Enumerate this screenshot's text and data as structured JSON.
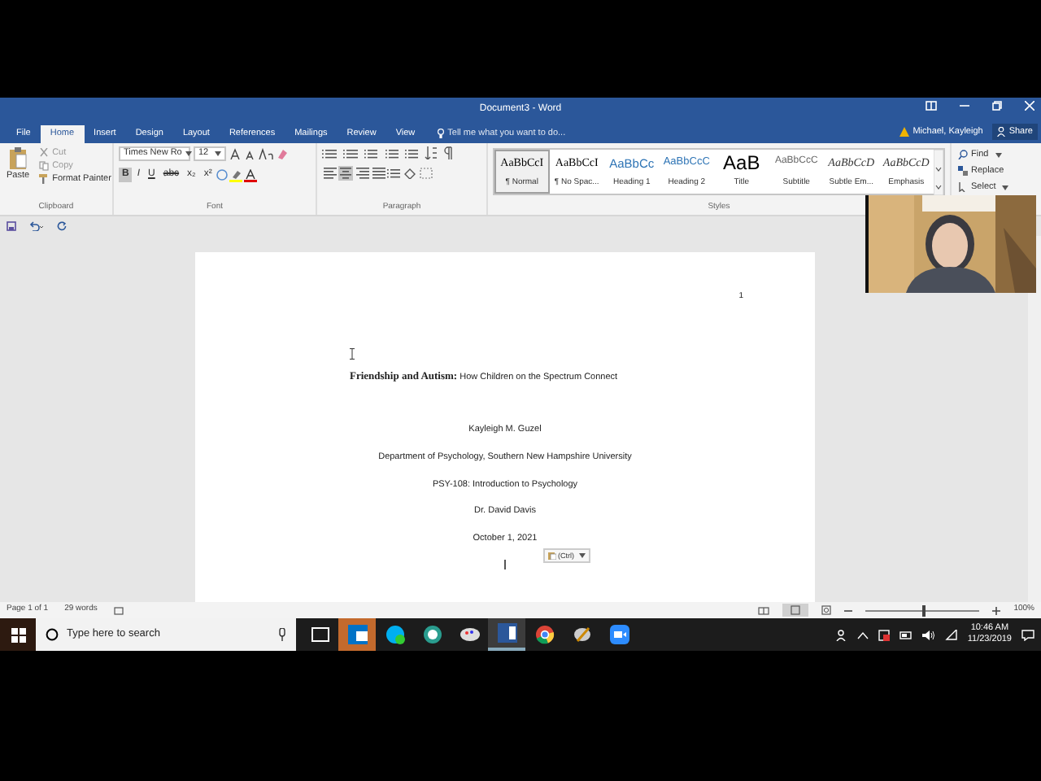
{
  "window": {
    "title": "Document3 - Word"
  },
  "tabs": [
    {
      "label": "File",
      "selected": false
    },
    {
      "label": "Home",
      "selected": true
    },
    {
      "label": "Insert",
      "selected": false
    },
    {
      "label": "Design",
      "selected": false
    },
    {
      "label": "Layout",
      "selected": false
    },
    {
      "label": "References",
      "selected": false
    },
    {
      "label": "Mailings",
      "selected": false
    },
    {
      "label": "Review",
      "selected": false
    },
    {
      "label": "View",
      "selected": false
    }
  ],
  "tell_me": {
    "placeholder": "Tell me what you want to do..."
  },
  "user": "Michael, Kayleigh",
  "share": "Share",
  "clipboard": {
    "paste": "Paste",
    "cut": "Cut",
    "copy": "Copy",
    "format_painter": "Format Painter",
    "label": "Clipboard"
  },
  "font": {
    "name": "Times New Ro",
    "size": "12",
    "label": "Font",
    "formats": [
      {
        "label": "B",
        "on": true
      },
      {
        "label": "I",
        "on": false
      },
      {
        "label": "U",
        "on": false
      },
      {
        "label": "abc",
        "on": false
      },
      {
        "label": "x₂",
        "on": false
      },
      {
        "label": "x²",
        "on": false
      }
    ]
  },
  "paragraph": {
    "label": "Paragraph",
    "alignments": [
      {
        "selected": false
      },
      {
        "selected": true
      },
      {
        "selected": false
      },
      {
        "selected": false
      }
    ]
  },
  "styles": {
    "label": "Styles",
    "items": [
      {
        "preview": "AaBbCcI",
        "name": "¶ Normal",
        "kind": "normal",
        "selected": true
      },
      {
        "preview": "AaBbCcI",
        "name": "¶ No Spac...",
        "kind": "normal",
        "selected": false
      },
      {
        "preview": "AaBbCc",
        "name": "Heading 1",
        "kind": "heading",
        "selected": false
      },
      {
        "preview": "AaBbCcC",
        "name": "Heading 2",
        "kind": "heading2",
        "selected": false
      },
      {
        "preview": "AaB",
        "name": "Title",
        "kind": "title",
        "selected": false
      },
      {
        "preview": "AaBbCcC",
        "name": "Subtitle",
        "kind": "subtitle",
        "selected": false
      },
      {
        "preview": "AaBbCcD",
        "name": "Subtle Em...",
        "kind": "emphasis",
        "selected": false
      },
      {
        "preview": "AaBbCcD",
        "name": "Emphasis",
        "kind": "emphasis",
        "selected": false
      }
    ]
  },
  "editing": [
    "Find",
    "Replace",
    "Select"
  ],
  "document": {
    "page_number": "1",
    "title": "**Friendship and Autism:** How Children on the Spectrum Connect",
    "lines": [
      "Kayleigh M. Guzel",
      "Department of Psychology, Southern New Hampshire University",
      "PSY-108: Introduction to Psychology",
      "Dr. David Davis",
      "October 1, 2021"
    ],
    "paste_options": "(Ctrl)"
  },
  "status_bar": {
    "page": "Page 1 of 1",
    "words": "29 words",
    "zoom": {
      "level": 0.5,
      "reading": "100%"
    }
  },
  "taskbar": {
    "search": {
      "placeholder": "Type here to search"
    },
    "time": "10:46 AM",
    "date": "11/23/2019"
  }
}
